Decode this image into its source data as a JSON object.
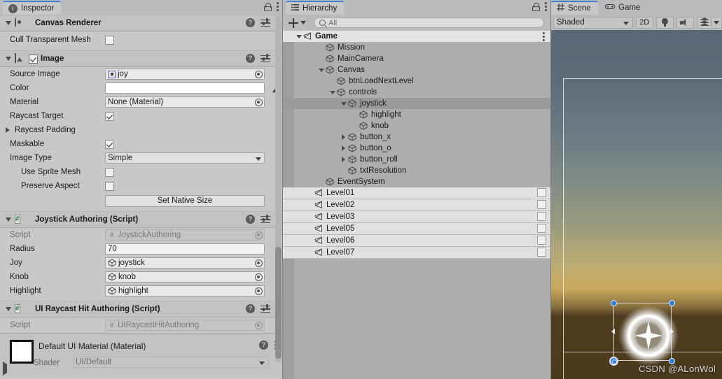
{
  "inspector": {
    "tab": "Inspector",
    "components": [
      {
        "name": "Canvas Renderer",
        "icon": "canvas-renderer-icon",
        "rows": [
          {
            "label": "Cull Transparent Mesh",
            "type": "checkbox",
            "value": false
          }
        ]
      },
      {
        "name": "Image",
        "icon": "image-icon",
        "enabled": true,
        "rows": [
          {
            "label": "Source Image",
            "type": "object",
            "value": "joy"
          },
          {
            "label": "Color",
            "type": "color",
            "value": "#FFFFFF"
          },
          {
            "label": "Material",
            "type": "object",
            "value": "None (Material)"
          },
          {
            "label": "Raycast Target",
            "type": "checkbox",
            "value": true
          },
          {
            "label": "Raycast Padding",
            "type": "foldout"
          },
          {
            "label": "Maskable",
            "type": "checkbox",
            "value": true
          },
          {
            "label": "Image Type",
            "type": "dropdown",
            "value": "Simple"
          },
          {
            "label": "Use Sprite Mesh",
            "type": "checkbox",
            "value": false,
            "indent": true
          },
          {
            "label": "Preserve Aspect",
            "type": "checkbox",
            "value": false,
            "indent": true
          },
          {
            "label": "",
            "type": "button",
            "value": "Set Native Size"
          }
        ]
      },
      {
        "name": "Joystick Authoring (Script)",
        "icon": "script-icon",
        "rows": [
          {
            "label": "Script",
            "type": "script",
            "value": "JoystickAuthoring"
          },
          {
            "label": "Radius",
            "type": "text",
            "value": "70"
          },
          {
            "label": "Joy",
            "type": "gameobject",
            "value": "joystick"
          },
          {
            "label": "Knob",
            "type": "gameobject",
            "value": "knob"
          },
          {
            "label": "Highlight",
            "type": "gameobject",
            "value": "highlight"
          }
        ]
      },
      {
        "name": "UI Raycast Hit Authoring (Script)",
        "icon": "script-icon",
        "rows": [
          {
            "label": "Script",
            "type": "script",
            "value": "UIRaycastHitAuthoring"
          }
        ]
      }
    ],
    "material": {
      "title": "Default UI Material (Material)",
      "shader_label": "Shader",
      "shader_value": "UI/Default"
    }
  },
  "hierarchy": {
    "tab": "Hierarchy",
    "create_label": "+",
    "search_placeholder": "All",
    "items": [
      {
        "label": "Game",
        "depth": 0,
        "twisty": "down",
        "kind": "scene",
        "selected": false
      },
      {
        "label": "Mission",
        "depth": 2,
        "twisty": "none",
        "kind": "gameobject",
        "selected": false
      },
      {
        "label": "MainCamera",
        "depth": 2,
        "twisty": "none",
        "kind": "gameobject",
        "selected": false
      },
      {
        "label": "Canvas",
        "depth": 2,
        "twisty": "down",
        "kind": "gameobject",
        "selected": false
      },
      {
        "label": "btnLoadNextLevel",
        "depth": 3,
        "twisty": "none",
        "kind": "gameobject",
        "selected": false
      },
      {
        "label": "controls",
        "depth": 3,
        "twisty": "down",
        "kind": "gameobject",
        "selected": false
      },
      {
        "label": "joystick",
        "depth": 4,
        "twisty": "down",
        "kind": "gameobject",
        "selected": true
      },
      {
        "label": "highlight",
        "depth": 5,
        "twisty": "none",
        "kind": "gameobject",
        "selected": false
      },
      {
        "label": "knob",
        "depth": 5,
        "twisty": "none",
        "kind": "gameobject",
        "selected": false
      },
      {
        "label": "button_x",
        "depth": 4,
        "twisty": "right",
        "kind": "gameobject",
        "selected": false
      },
      {
        "label": "button_o",
        "depth": 4,
        "twisty": "right",
        "kind": "gameobject",
        "selected": false
      },
      {
        "label": "button_roll",
        "depth": 4,
        "twisty": "right",
        "kind": "gameobject",
        "selected": false
      },
      {
        "label": "txtResolution",
        "depth": 4,
        "twisty": "none",
        "kind": "gameobject",
        "selected": false
      },
      {
        "label": "EventSystem",
        "depth": 2,
        "twisty": "none",
        "kind": "gameobject",
        "selected": false
      },
      {
        "label": "Level01",
        "depth": 1,
        "twisty": "none",
        "kind": "scene-row",
        "selected": false
      },
      {
        "label": "Level02",
        "depth": 1,
        "twisty": "none",
        "kind": "scene-row",
        "selected": false
      },
      {
        "label": "Level03",
        "depth": 1,
        "twisty": "none",
        "kind": "scene-row",
        "selected": false
      },
      {
        "label": "Level05",
        "depth": 1,
        "twisty": "none",
        "kind": "scene-row",
        "selected": false
      },
      {
        "label": "Level06",
        "depth": 1,
        "twisty": "none",
        "kind": "scene-row",
        "selected": false
      },
      {
        "label": "Level07",
        "depth": 1,
        "twisty": "none",
        "kind": "scene-row",
        "selected": false
      }
    ]
  },
  "scene": {
    "tabs": [
      {
        "label": "Scene",
        "active": true
      },
      {
        "label": "Game",
        "active": false
      }
    ],
    "draw_mode": "Shaded",
    "toggle_2d": "2D",
    "lighting_icon": "lightbulb-icon",
    "audio_icon": "speaker-icon",
    "fx_icon": "fx-layers-icon",
    "watermark": "CSDN @ALonWol"
  }
}
